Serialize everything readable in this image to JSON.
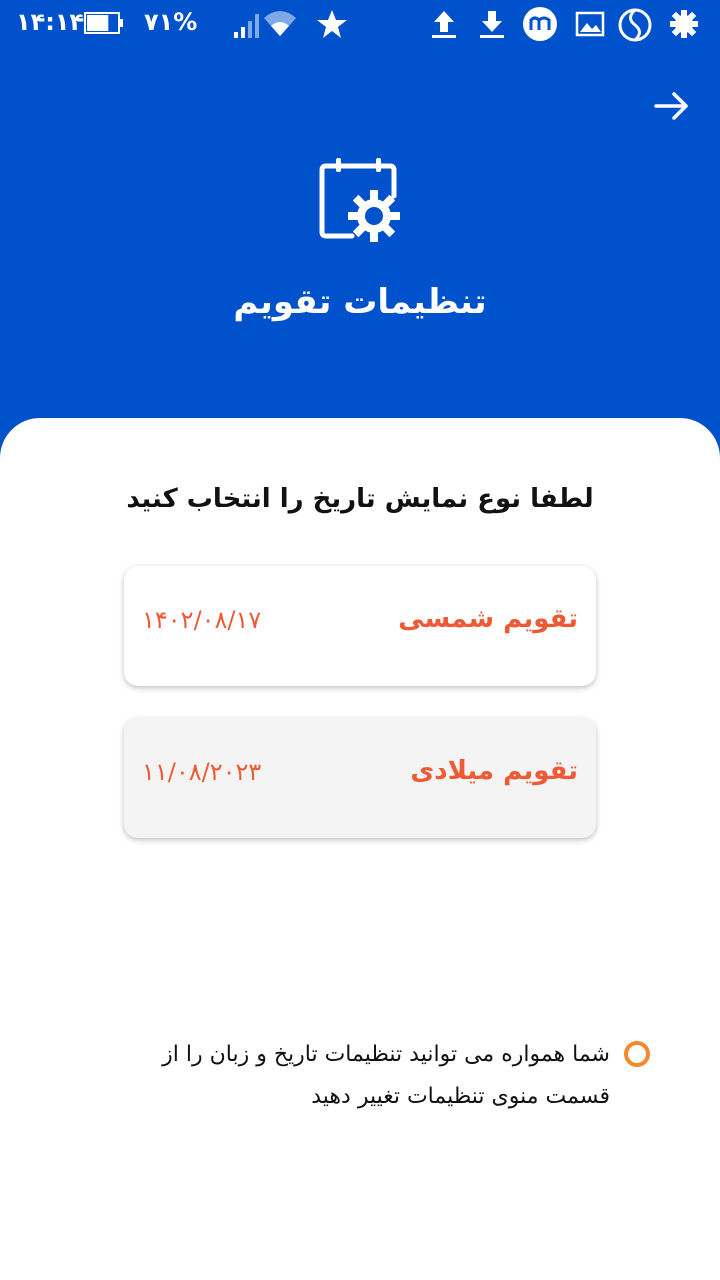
{
  "status_bar": {
    "time": "۱۴:۱۴",
    "battery_percent": "۷۱%",
    "battery_level": 0.71,
    "icons": [
      "signal-icon",
      "wifi-icon",
      "star-icon",
      "upload-icon",
      "download-icon",
      "m-app-icon",
      "image-icon",
      "s-app-icon",
      "gear-icon"
    ]
  },
  "header": {
    "title": "تنظیمات تقویم",
    "icon": "calendar-settings-icon",
    "back_icon": "arrow-right-icon",
    "color": "#0052cc"
  },
  "main": {
    "prompt": "لطفا نوع نمایش تاریخ را انتخاب کنید",
    "options": [
      {
        "label": "تقویم شمسی",
        "date": "۱۴۰۲/۰۸/۱۷"
      },
      {
        "label": "تقویم میلادی",
        "date": "۱۱/۰۸/۲۰۲۳"
      }
    ],
    "accent_color": "#ee5a35"
  },
  "note": {
    "text": "شما همواره می توانید تنظیمات تاریخ و زبان را از قسمت منوی تنظیمات تغییر دهید",
    "bullet_color": "#f5892a"
  }
}
